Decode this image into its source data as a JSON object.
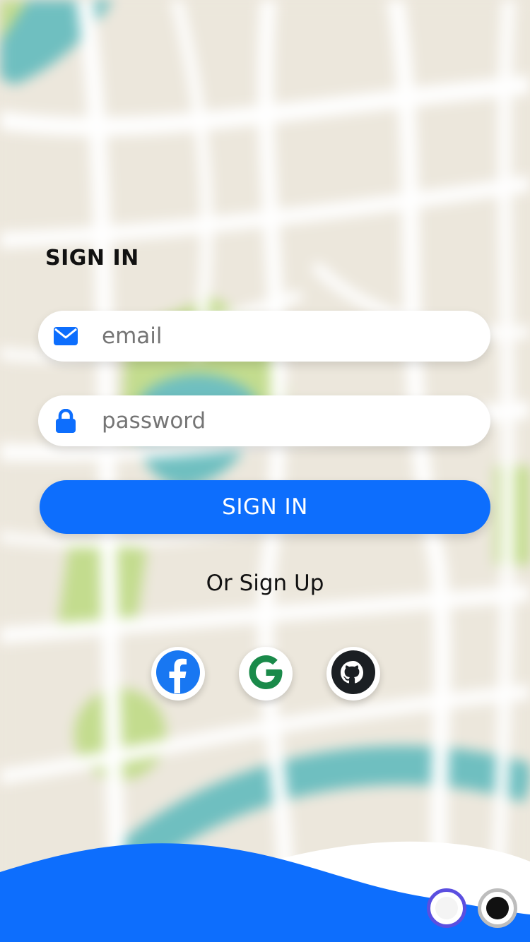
{
  "heading": "SIGN IN",
  "email_field": {
    "placeholder": "email",
    "icon": "envelope-icon"
  },
  "password_field": {
    "placeholder": "password",
    "icon": "lock-icon"
  },
  "signin_button": "SIGN IN",
  "signup_link": "Or Sign Up",
  "social": [
    {
      "icon": "facebook-icon",
      "color": "#1877f2"
    },
    {
      "icon": "google-icon",
      "color": "#1a8a4a"
    },
    {
      "icon": "github-icon",
      "color": "#1b1f23"
    }
  ],
  "theme_toggle": [
    {
      "icon": "light-theme-icon",
      "selected": true,
      "ring": "#5b4fe0",
      "fill": "#f4f4f4"
    },
    {
      "icon": "dark-theme-icon",
      "selected": false,
      "ring": "#bdbdbd",
      "fill": "#111111"
    }
  ],
  "colors": {
    "primary": "#0d6efd",
    "map_land": "#ece7dc",
    "map_road": "#ffffff",
    "map_park": "#c3dc8e",
    "map_water": "#6fbfc0"
  }
}
